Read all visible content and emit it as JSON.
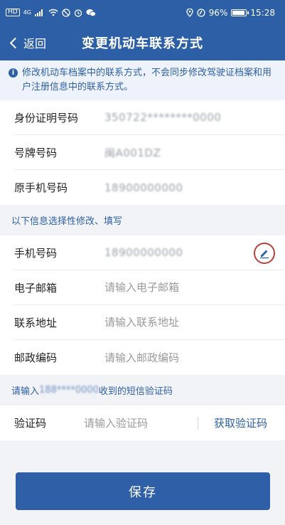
{
  "status_bar": {
    "left_badge": "HD",
    "network": "4G",
    "right_battery_text": "96%",
    "battery_level": 0.96,
    "time": "15:28"
  },
  "nav": {
    "back_label": "返回",
    "title": "变更机动车联系方式"
  },
  "notice": {
    "icon": "info-icon",
    "text": "修改机动车档案中的联系方式，不会同步修改驾驶证档案和用户注册信息中的联系方式。"
  },
  "fixed_info": [
    {
      "label": "身份证明号码",
      "value": "350722********0000"
    },
    {
      "label": "号牌号码",
      "value": "闽A001DZ"
    },
    {
      "label": "原手机号码",
      "value": "18900000000"
    }
  ],
  "optional_section_title": "以下信息选择性修改、填写",
  "optional_fields": {
    "phone": {
      "label": "手机号码",
      "value": "18900000000"
    },
    "email": {
      "label": "电子邮箱",
      "placeholder": "请输入电子邮箱"
    },
    "address": {
      "label": "联系地址",
      "placeholder": "请输入联系地址"
    },
    "postcode": {
      "label": "邮政编码",
      "placeholder": "请输入邮政编码"
    }
  },
  "verify_prompt": {
    "prefix": "请输入",
    "masked_phone": "188****0000",
    "suffix": "收到的短信验证码"
  },
  "verify": {
    "label": "验证码",
    "placeholder": "请输入验证码",
    "get_code_label": "获取验证码"
  },
  "save_label": "保存",
  "colors": {
    "primary": "#2d5fa6",
    "edit_circle": "#b8413a"
  }
}
